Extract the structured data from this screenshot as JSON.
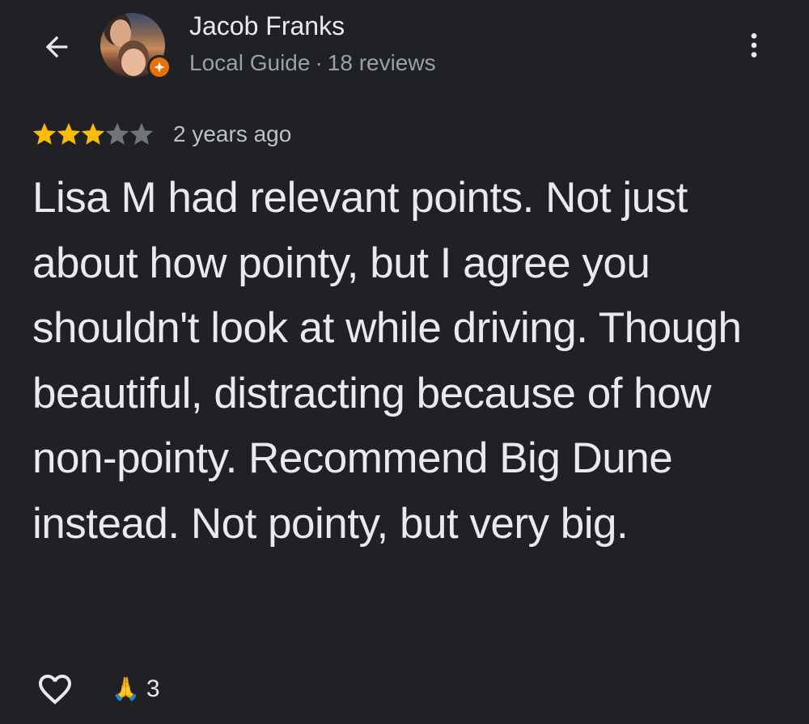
{
  "header": {
    "back_icon": "arrow-left-icon",
    "user_name": "Jacob Franks",
    "user_level": "Local Guide",
    "separator": "·",
    "review_count": "18 reviews",
    "badge_icon": "local-guide-star-icon",
    "more_icon": "more-vert-icon"
  },
  "review": {
    "rating": 3,
    "max_rating": 5,
    "time_ago": "2 years ago",
    "text": "Lisa M had relevant points. Not just about how pointy, but I agree you shouldn't look at while driving. Though beautiful, distracting because of how non-pointy. Recommend Big Dune instead. Not pointy, but very big."
  },
  "actions": {
    "like_icon": "heart-outline-icon",
    "reaction_emoji": "🙏",
    "reaction_count": "3"
  },
  "colors": {
    "background": "#202124",
    "star_filled": "#fbbc04",
    "star_empty": "#70757a",
    "badge": "#e8710a",
    "text_primary": "#e8eaed",
    "text_secondary": "#9aa0a6"
  }
}
